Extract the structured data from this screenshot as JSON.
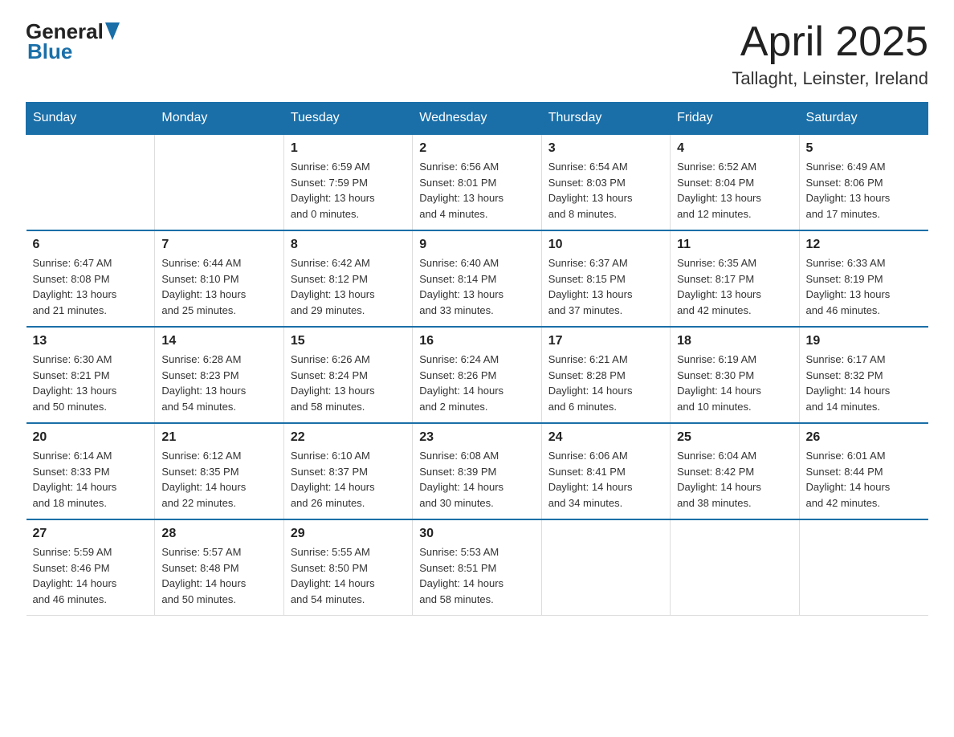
{
  "header": {
    "logo_general": "General",
    "logo_blue": "Blue",
    "month_title": "April 2025",
    "location": "Tallaght, Leinster, Ireland"
  },
  "weekdays": [
    "Sunday",
    "Monday",
    "Tuesday",
    "Wednesday",
    "Thursday",
    "Friday",
    "Saturday"
  ],
  "weeks": [
    [
      {
        "day": "",
        "info": ""
      },
      {
        "day": "",
        "info": ""
      },
      {
        "day": "1",
        "info": "Sunrise: 6:59 AM\nSunset: 7:59 PM\nDaylight: 13 hours\nand 0 minutes."
      },
      {
        "day": "2",
        "info": "Sunrise: 6:56 AM\nSunset: 8:01 PM\nDaylight: 13 hours\nand 4 minutes."
      },
      {
        "day": "3",
        "info": "Sunrise: 6:54 AM\nSunset: 8:03 PM\nDaylight: 13 hours\nand 8 minutes."
      },
      {
        "day": "4",
        "info": "Sunrise: 6:52 AM\nSunset: 8:04 PM\nDaylight: 13 hours\nand 12 minutes."
      },
      {
        "day": "5",
        "info": "Sunrise: 6:49 AM\nSunset: 8:06 PM\nDaylight: 13 hours\nand 17 minutes."
      }
    ],
    [
      {
        "day": "6",
        "info": "Sunrise: 6:47 AM\nSunset: 8:08 PM\nDaylight: 13 hours\nand 21 minutes."
      },
      {
        "day": "7",
        "info": "Sunrise: 6:44 AM\nSunset: 8:10 PM\nDaylight: 13 hours\nand 25 minutes."
      },
      {
        "day": "8",
        "info": "Sunrise: 6:42 AM\nSunset: 8:12 PM\nDaylight: 13 hours\nand 29 minutes."
      },
      {
        "day": "9",
        "info": "Sunrise: 6:40 AM\nSunset: 8:14 PM\nDaylight: 13 hours\nand 33 minutes."
      },
      {
        "day": "10",
        "info": "Sunrise: 6:37 AM\nSunset: 8:15 PM\nDaylight: 13 hours\nand 37 minutes."
      },
      {
        "day": "11",
        "info": "Sunrise: 6:35 AM\nSunset: 8:17 PM\nDaylight: 13 hours\nand 42 minutes."
      },
      {
        "day": "12",
        "info": "Sunrise: 6:33 AM\nSunset: 8:19 PM\nDaylight: 13 hours\nand 46 minutes."
      }
    ],
    [
      {
        "day": "13",
        "info": "Sunrise: 6:30 AM\nSunset: 8:21 PM\nDaylight: 13 hours\nand 50 minutes."
      },
      {
        "day": "14",
        "info": "Sunrise: 6:28 AM\nSunset: 8:23 PM\nDaylight: 13 hours\nand 54 minutes."
      },
      {
        "day": "15",
        "info": "Sunrise: 6:26 AM\nSunset: 8:24 PM\nDaylight: 13 hours\nand 58 minutes."
      },
      {
        "day": "16",
        "info": "Sunrise: 6:24 AM\nSunset: 8:26 PM\nDaylight: 14 hours\nand 2 minutes."
      },
      {
        "day": "17",
        "info": "Sunrise: 6:21 AM\nSunset: 8:28 PM\nDaylight: 14 hours\nand 6 minutes."
      },
      {
        "day": "18",
        "info": "Sunrise: 6:19 AM\nSunset: 8:30 PM\nDaylight: 14 hours\nand 10 minutes."
      },
      {
        "day": "19",
        "info": "Sunrise: 6:17 AM\nSunset: 8:32 PM\nDaylight: 14 hours\nand 14 minutes."
      }
    ],
    [
      {
        "day": "20",
        "info": "Sunrise: 6:14 AM\nSunset: 8:33 PM\nDaylight: 14 hours\nand 18 minutes."
      },
      {
        "day": "21",
        "info": "Sunrise: 6:12 AM\nSunset: 8:35 PM\nDaylight: 14 hours\nand 22 minutes."
      },
      {
        "day": "22",
        "info": "Sunrise: 6:10 AM\nSunset: 8:37 PM\nDaylight: 14 hours\nand 26 minutes."
      },
      {
        "day": "23",
        "info": "Sunrise: 6:08 AM\nSunset: 8:39 PM\nDaylight: 14 hours\nand 30 minutes."
      },
      {
        "day": "24",
        "info": "Sunrise: 6:06 AM\nSunset: 8:41 PM\nDaylight: 14 hours\nand 34 minutes."
      },
      {
        "day": "25",
        "info": "Sunrise: 6:04 AM\nSunset: 8:42 PM\nDaylight: 14 hours\nand 38 minutes."
      },
      {
        "day": "26",
        "info": "Sunrise: 6:01 AM\nSunset: 8:44 PM\nDaylight: 14 hours\nand 42 minutes."
      }
    ],
    [
      {
        "day": "27",
        "info": "Sunrise: 5:59 AM\nSunset: 8:46 PM\nDaylight: 14 hours\nand 46 minutes."
      },
      {
        "day": "28",
        "info": "Sunrise: 5:57 AM\nSunset: 8:48 PM\nDaylight: 14 hours\nand 50 minutes."
      },
      {
        "day": "29",
        "info": "Sunrise: 5:55 AM\nSunset: 8:50 PM\nDaylight: 14 hours\nand 54 minutes."
      },
      {
        "day": "30",
        "info": "Sunrise: 5:53 AM\nSunset: 8:51 PM\nDaylight: 14 hours\nand 58 minutes."
      },
      {
        "day": "",
        "info": ""
      },
      {
        "day": "",
        "info": ""
      },
      {
        "day": "",
        "info": ""
      }
    ]
  ]
}
